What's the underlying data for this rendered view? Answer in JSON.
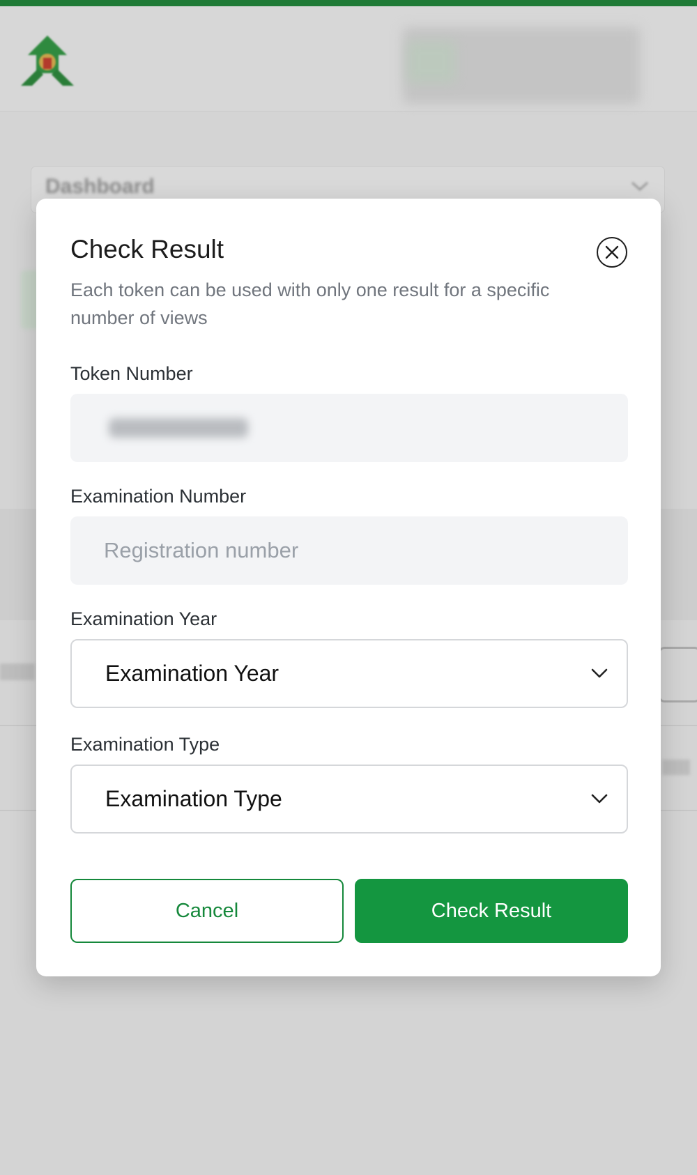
{
  "background": {
    "dashboard_label": "Dashboard"
  },
  "modal": {
    "title": "Check Result",
    "description": "Each token can be used with only one result for a specific number of views",
    "fields": {
      "token": {
        "label": "Token Number"
      },
      "exam_number": {
        "label": "Examination Number",
        "placeholder": "Registration number"
      },
      "exam_year": {
        "label": "Examination Year",
        "value": "Examination Year"
      },
      "exam_type": {
        "label": "Examination Type",
        "value": "Examination Type"
      }
    },
    "buttons": {
      "cancel": "Cancel",
      "submit": "Check Result"
    }
  },
  "colors": {
    "brand_green": "#149640",
    "top_stripe": "#1f7a36",
    "overlay": "#d2d2d2"
  },
  "icons": [
    "logo-icon",
    "close-icon",
    "chevron-down-icon"
  ]
}
